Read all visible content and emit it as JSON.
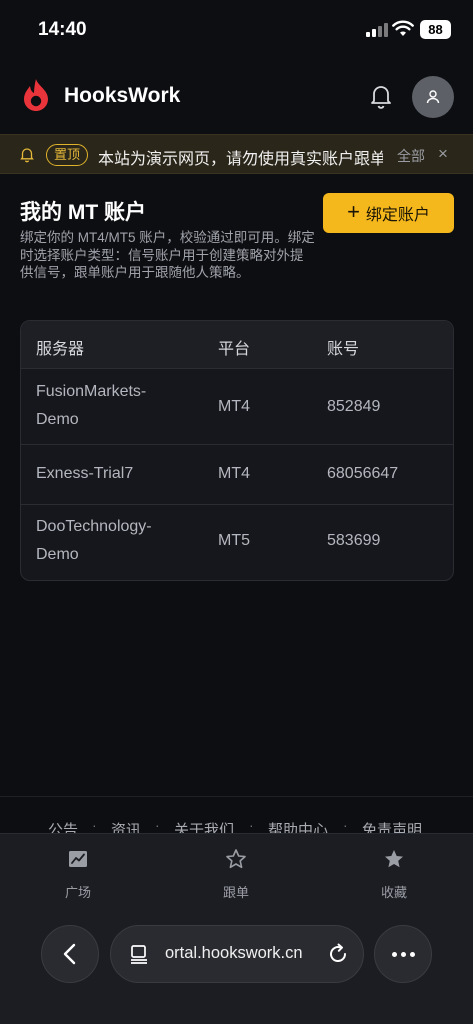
{
  "status_bar": {
    "time": "14:40",
    "battery": "88"
  },
  "header": {
    "brand": "HooksWork"
  },
  "notice": {
    "tag": "置顶",
    "text": "本站为演示网页，请勿使用真实账户跟单",
    "all_label": "全部",
    "close_label": "×"
  },
  "main": {
    "title": "我的 MT 账户",
    "description": "绑定你的 MT4/MT5 账户，校验通过即可用。绑定时选择账户类型：信号账户用于创建策略对外提供信号，跟单账户用于跟随他人策略。",
    "bind_button": "绑定账户"
  },
  "table": {
    "headers": [
      "服务器",
      "平台",
      "账号"
    ],
    "rows": [
      {
        "server_line1": "FusionMarkets-",
        "server_line2": "Demo",
        "platform": "MT4",
        "account": "852849"
      },
      {
        "server_line1": "Exness-Trial7",
        "server_line2": "",
        "platform": "MT4",
        "account": "68056647"
      },
      {
        "server_line1": "DooTechnology-",
        "server_line2": "Demo",
        "platform": "MT5",
        "account": "583699"
      }
    ]
  },
  "footer_links": [
    "公告",
    "资讯",
    "关于我们",
    "帮助中心",
    "免责声明"
  ],
  "bottom_nav": [
    {
      "label": "广场",
      "icon": "chart-icon"
    },
    {
      "label": "跟单",
      "icon": "star-outline-icon"
    },
    {
      "label": "收藏",
      "icon": "star-filled-icon"
    }
  ],
  "browser": {
    "url": "ortal.hookswork.cn"
  }
}
